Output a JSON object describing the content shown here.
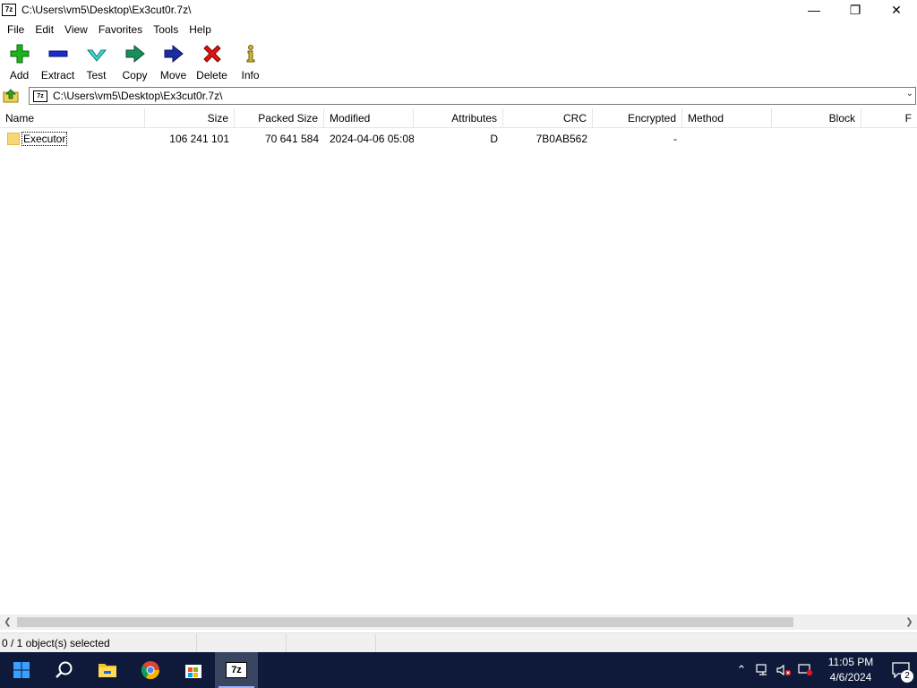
{
  "window": {
    "title": "C:\\Users\\vm5\\Desktop\\Ex3cut0r.7z\\",
    "app_icon_text": "7z",
    "minimize_glyph": "—",
    "restore_glyph": "❐",
    "close_glyph": "✕"
  },
  "menu": [
    "File",
    "Edit",
    "View",
    "Favorites",
    "Tools",
    "Help"
  ],
  "toolbar": {
    "add": "Add",
    "extract": "Extract",
    "test": "Test",
    "copy": "Copy",
    "move": "Move",
    "delete": "Delete",
    "info": "Info"
  },
  "address": {
    "path": "C:\\Users\\vm5\\Desktop\\Ex3cut0r.7z\\",
    "icon_text": "7z"
  },
  "columns": [
    "Name",
    "Size",
    "Packed Size",
    "Modified",
    "Attributes",
    "CRC",
    "Encrypted",
    "Method",
    "Block",
    "F"
  ],
  "rows": [
    {
      "name": "Executor",
      "size": "106 241 101",
      "packed_size": "70 641 584",
      "modified": "2024-04-06 05:08",
      "attributes": "D",
      "crc": "7B0AB562",
      "encrypted": "-",
      "method": "",
      "block": ""
    }
  ],
  "status": {
    "selection": "0 / 1 object(s) selected"
  },
  "taskbar": {
    "time": "11:05 PM",
    "date": "4/6/2024",
    "notifications": "2",
    "sevenzip_text": "7z"
  },
  "colors": {
    "taskbar_bg": "#0f1a3a",
    "accent": "#0078d7",
    "folder": "#f8d775"
  }
}
